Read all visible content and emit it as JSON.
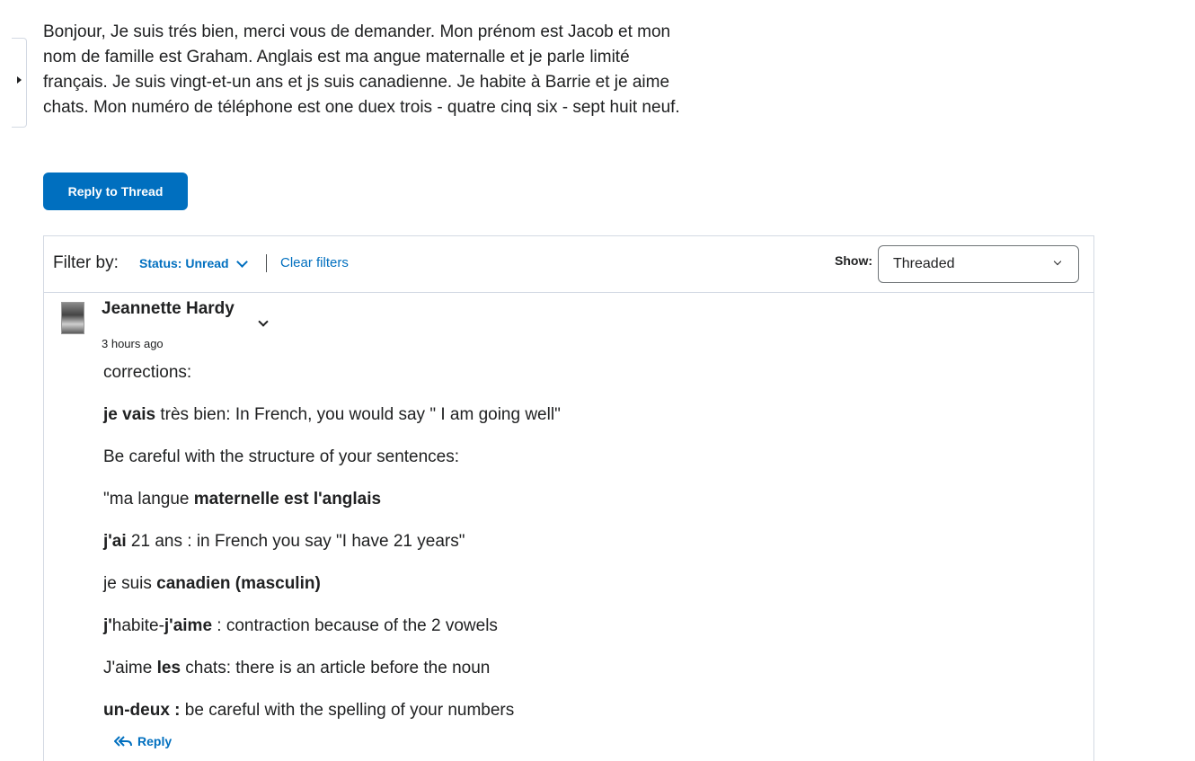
{
  "post": {
    "body": "Bonjour, Je suis trés bien, merci vous de demander. Mon prénom est Jacob et mon nom de famille est Graham. Anglais est ma angue maternalle et je parle limité français. Je suis vingt-et-un ans et js suis canadienne. Je habite à Barrie et je aime chats. Mon numéro de téléphone est one duex trois - quatre cinq six - sept huit neuf.",
    "reply_to_thread_label": "Reply to Thread"
  },
  "filters": {
    "filter_by_label": "Filter by:",
    "status_label": "Status: Unread",
    "clear_label": "Clear filters",
    "show_label": "Show:",
    "show_value": "Threaded"
  },
  "reply": {
    "author": "Jeannette Hardy",
    "timestamp": "3 hours ago",
    "lines": [
      {
        "bold": "",
        "text": "corrections:"
      },
      {
        "bold": "je vais",
        "text": " très bien: In French, you would say \" I am going well\""
      },
      {
        "bold": "",
        "text": "Be careful with the structure of your sentences:"
      },
      {
        "pre": "\"ma langue ",
        "bold": "maternelle est l'anglais",
        "text": ""
      },
      {
        "bold": "j'ai",
        "text": " 21 ans : in French you say \"I have 21 years\""
      },
      {
        "pre": "je suis ",
        "bold": "canadien (masculin)",
        "text": ""
      },
      {
        "bold": "j'",
        "text": "habite-",
        "bold2": "j'aime",
        "text2": " : contraction because of the 2 vowels"
      },
      {
        "pre": "J'aime ",
        "bold": "les",
        "text": " chats: there is an article before the noun"
      },
      {
        "bold": "un-deux :",
        "text": " be careful with the spelling of your numbers"
      }
    ],
    "reply_label": "Reply"
  },
  "icons": {
    "side_toggle": "caret-right-icon",
    "status_dropdown": "chevron-down-icon",
    "author_menu": "chevron-down-icon",
    "reply": "reply-all-icon"
  },
  "colors": {
    "accent": "#006fbf",
    "border": "#d3d9e3",
    "text": "#202122"
  }
}
